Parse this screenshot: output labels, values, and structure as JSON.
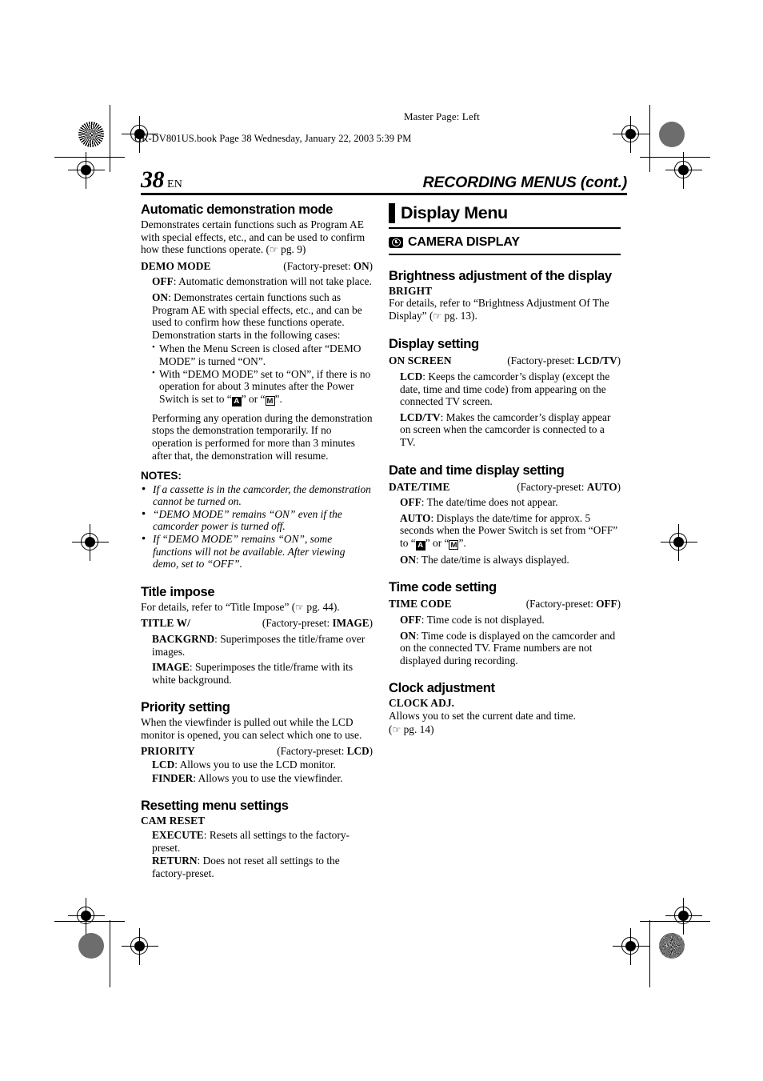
{
  "print_marks": {
    "master_page": "Master Page: Left",
    "book_line": "GR-DV801US.book  Page 38  Wednesday, January 22, 2003  5:39 PM"
  },
  "header": {
    "page_number": "38",
    "language": "EN",
    "running_head": "RECORDING MENUS (cont.)"
  },
  "left_column": {
    "sections": [
      {
        "heading": "Automatic demonstration mode",
        "intro": "Demonstrates certain functions such as Program AE with special effects, etc., and can be used to confirm how these functions operate. (",
        "intro_ref": "pg. 9)",
        "setting_name": "DEMO MODE",
        "preset_prefix": "(Factory-preset: ",
        "preset_value": "ON",
        "preset_suffix": ")",
        "options": [
          {
            "key": "OFF",
            "text": ": Automatic demonstration will not take place."
          },
          {
            "key": "ON",
            "text": ": Demonstrates certain functions such as Program AE with special effects, etc., and can be used to confirm how these functions operate. Demonstration starts in the following cases:"
          }
        ],
        "bullets": [
          "When the Menu Screen is closed after “DEMO MODE” is turned “ON”.",
          "With “DEMO MODE” set to “ON”, if there is no operation for about 3 minutes after the Power Switch is set to “"
        ],
        "bullet2_mid": "” or “",
        "bullet2_end": "”.",
        "badge_a": "A",
        "badge_m": "M",
        "closing": "Performing any operation during the demonstration stops the demonstration temporarily. If no operation is performed for more than 3 minutes after that, the demonstration will resume.",
        "notes_label": "NOTES:",
        "notes": [
          "If a cassette is in the camcorder, the demonstration cannot be turned on.",
          "“DEMO MODE” remains “ON” even if the camcorder power is turned off.",
          "If “DEMO MODE” remains “ON”, some functions will not be available. After viewing demo, set to “OFF”."
        ]
      },
      {
        "heading": "Title impose",
        "intro": "For details, refer to “Title Impose” (",
        "intro_ref": "pg. 44).",
        "setting_name": "TITLE W/",
        "preset_prefix": "(Factory-preset: ",
        "preset_value": "IMAGE",
        "preset_suffix": ")",
        "options": [
          {
            "key": "BACKGRND",
            "text": ": Superimposes the title/frame over images."
          },
          {
            "key": "IMAGE",
            "text": ": Superimposes the title/frame with its white background."
          }
        ]
      },
      {
        "heading": "Priority setting",
        "intro": "When the viewfinder is pulled out while the LCD monitor is opened, you can select which one to use.",
        "setting_name": "PRIORITY",
        "preset_prefix": "(Factory-preset: ",
        "preset_value": "LCD",
        "preset_suffix": ")",
        "options": [
          {
            "key": "LCD",
            "text": ": Allows you to use the LCD monitor."
          },
          {
            "key": "FINDER",
            "text": ": Allows you to use the viewfinder."
          }
        ]
      },
      {
        "heading": "Resetting menu settings",
        "setting_name": "CAM RESET",
        "options": [
          {
            "key": "EXECUTE",
            "text": ": Resets all settings to the factory-preset."
          },
          {
            "key": "RETURN",
            "text": ": Does not reset all settings to the factory-preset."
          }
        ]
      }
    ]
  },
  "right_column": {
    "menu_title": "Display Menu",
    "category": "CAMERA DISPLAY",
    "category_icon": "camera-display-icon",
    "sections": [
      {
        "heading": "Brightness adjustment of the display",
        "setting_name": "BRIGHT",
        "intro": "For details, refer to “Brightness Adjustment Of The Display” (",
        "intro_ref": "pg. 13)."
      },
      {
        "heading": "Display setting",
        "setting_name": "ON SCREEN",
        "preset_prefix": "(Factory-preset: ",
        "preset_value": "LCD/TV",
        "preset_suffix": ")",
        "options": [
          {
            "key": "LCD",
            "text": ": Keeps the camcorder’s display (except the date, time and time code) from appearing on the connected TV screen."
          },
          {
            "key": "LCD/TV",
            "text": ": Makes the camcorder’s display appear on screen when the camcorder is connected to a TV."
          }
        ]
      },
      {
        "heading": "Date and time display setting",
        "setting_name": "DATE/TIME",
        "preset_prefix": "(Factory-preset: ",
        "preset_value": "AUTO",
        "preset_suffix": ")",
        "options": [
          {
            "key": "OFF",
            "text": ": The date/time does not appear."
          },
          {
            "key": "AUTO",
            "text": ": Displays the date/time for approx. 5 seconds when the Power Switch is set from “OFF” to “"
          },
          {
            "key": "ON",
            "text": ": The date/time is always displayed."
          }
        ],
        "auto_mid": "” or “",
        "auto_end": "”.",
        "badge_a": "A",
        "badge_m": "M"
      },
      {
        "heading": "Time code setting",
        "setting_name": "TIME CODE",
        "preset_prefix": "(Factory-preset: ",
        "preset_value": "OFF",
        "preset_suffix": ")",
        "options": [
          {
            "key": "OFF",
            "text": ": Time code is not displayed."
          },
          {
            "key": "ON",
            "text": ": Time code is displayed on the camcorder and on the connected TV. Frame numbers are not displayed during recording."
          }
        ]
      },
      {
        "heading": "Clock adjustment",
        "setting_name": "CLOCK ADJ.",
        "intro": "Allows you to set the current date and time.",
        "ref_line_prefix": "(",
        "ref_line": "pg. 14)"
      }
    ]
  }
}
